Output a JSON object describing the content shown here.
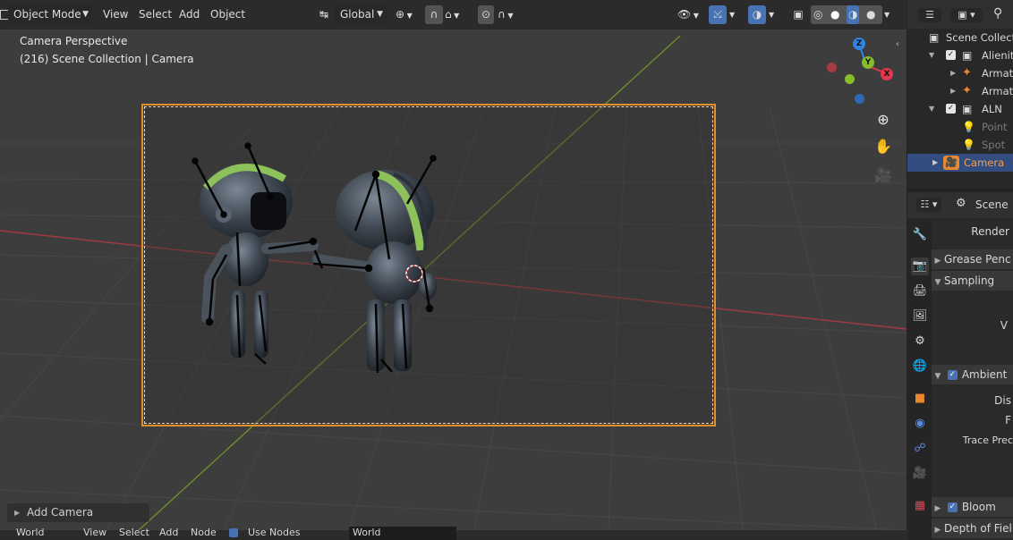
{
  "header": {
    "mode": "Object Mode",
    "menus": [
      "View",
      "Select",
      "Add",
      "Object"
    ],
    "orientation": "Global"
  },
  "viewport": {
    "perspective_label": "Camera Perspective",
    "collection_label": "(216) Scene Collection | Camera",
    "gizmo": {
      "z": "Z",
      "y": "Y",
      "x": "X"
    }
  },
  "last_operator": "Add Camera",
  "bottom_bar": {
    "world": "World",
    "menus": [
      "View",
      "Select",
      "Add",
      "Node"
    ],
    "use_nodes": "Use Nodes",
    "world_field": "World"
  },
  "outliner": {
    "rows": [
      {
        "label": "Scene Collecti",
        "kind": "collection"
      },
      {
        "label": "Alienito",
        "kind": "collection"
      },
      {
        "label": "Armatu",
        "kind": "armature"
      },
      {
        "label": "Armatu",
        "kind": "armature"
      },
      {
        "label": "ALN",
        "kind": "collection"
      },
      {
        "label": "Point",
        "kind": "light"
      },
      {
        "label": "Spot",
        "kind": "light"
      },
      {
        "label": "Camera",
        "kind": "camera"
      }
    ]
  },
  "properties": {
    "context": "Scene",
    "render_label": "Render",
    "panels": [
      {
        "label": "Grease Penc",
        "open": false
      },
      {
        "label": "Sampling",
        "open": true
      },
      {
        "label": "V",
        "open": false
      },
      {
        "label": "Ambient",
        "open": true
      },
      {
        "label": "Dis",
        "open": false
      },
      {
        "label": "F",
        "open": false
      },
      {
        "label": "Trace Prec",
        "open": false
      },
      {
        "label": "Bloom",
        "open": false
      },
      {
        "label": "Depth of Fiel",
        "open": false
      }
    ]
  },
  "colors": {
    "accent": "#4772b3",
    "camera_frame": "#e0902a",
    "axis_x": "#e3364f",
    "axis_y": "#86bd2c",
    "axis_z": "#2f84e3",
    "selected_row": "#334d80",
    "camera_text": "#f0a050"
  }
}
